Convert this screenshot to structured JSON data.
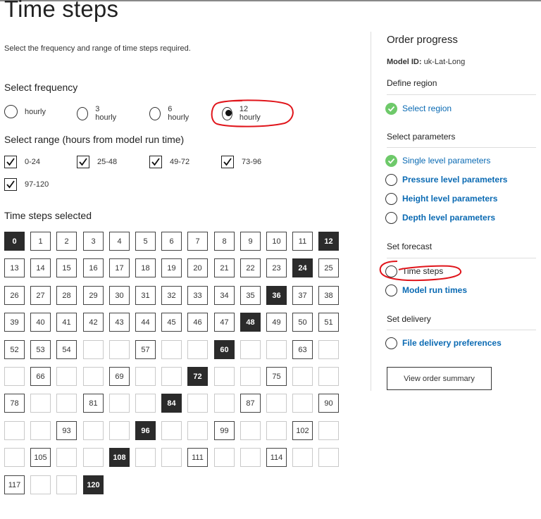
{
  "page": {
    "title": "Time steps",
    "intro": "Select the frequency and range of time steps required."
  },
  "frequency": {
    "heading": "Select frequency",
    "options": [
      "hourly",
      "3 hourly",
      "6 hourly",
      "12 hourly"
    ],
    "selected": "12 hourly"
  },
  "range": {
    "heading": "Select range (hours from model run time)",
    "options": [
      {
        "label": "0-24",
        "checked": true
      },
      {
        "label": "25-48",
        "checked": true
      },
      {
        "label": "49-72",
        "checked": true
      },
      {
        "label": "73-96",
        "checked": true
      },
      {
        "label": "97-120",
        "checked": true
      }
    ]
  },
  "timesteps": {
    "heading": "Time steps selected",
    "rows": [
      [
        "0",
        "1",
        "2",
        "3",
        "4",
        "5",
        "6",
        "7",
        "8",
        "9",
        "10",
        "11",
        "12"
      ],
      [
        "13",
        "14",
        "15",
        "16",
        "17",
        "18",
        "19",
        "20",
        "21",
        "22",
        "23",
        "24",
        "25"
      ],
      [
        "26",
        "27",
        "28",
        "29",
        "30",
        "31",
        "32",
        "33",
        "34",
        "35",
        "36",
        "37",
        "38"
      ],
      [
        "39",
        "40",
        "41",
        "42",
        "43",
        "44",
        "45",
        "46",
        "47",
        "48",
        "49",
        "50",
        "51"
      ],
      [
        "52",
        "53",
        "54",
        "",
        "",
        "57",
        "",
        "",
        "60",
        "",
        "",
        "63",
        ""
      ],
      [
        "",
        "66",
        "",
        "",
        "69",
        "",
        "",
        "72",
        "",
        "",
        "75",
        "",
        ""
      ],
      [
        "78",
        "",
        "",
        "81",
        "",
        "",
        "84",
        "",
        "",
        "87",
        "",
        "",
        "90"
      ],
      [
        "",
        "",
        "93",
        "",
        "",
        "96",
        "",
        "",
        "99",
        "",
        "",
        "102",
        ""
      ],
      [
        "",
        "105",
        "",
        "",
        "108",
        "",
        "",
        "111",
        "",
        "",
        "114",
        "",
        ""
      ],
      [
        "117",
        "",
        "",
        "120"
      ]
    ],
    "highlighted": [
      "0",
      "12",
      "24",
      "36",
      "48",
      "60",
      "72",
      "84",
      "96",
      "108",
      "120"
    ]
  },
  "sidebar": {
    "title": "Order progress",
    "model_label": "Model ID:",
    "model_value": "uk-Lat-Long",
    "sections": [
      {
        "heading": "Define region",
        "items": [
          {
            "label": "Select region",
            "done": true,
            "bold": false
          }
        ]
      },
      {
        "heading": "Select parameters",
        "items": [
          {
            "label": "Single level parameters",
            "done": true,
            "bold": false
          },
          {
            "label": "Pressure level parameters",
            "done": false,
            "bold": true
          },
          {
            "label": "Height level parameters",
            "done": false,
            "bold": true
          },
          {
            "label": "Depth level parameters",
            "done": false,
            "bold": true
          }
        ]
      },
      {
        "heading": "Set forecast",
        "items": [
          {
            "label": "Time steps",
            "done": false,
            "bold": false,
            "current": true
          },
          {
            "label": "Model run times",
            "done": false,
            "bold": true
          }
        ]
      },
      {
        "heading": "Set delivery",
        "items": [
          {
            "label": "File delivery preferences",
            "done": false,
            "bold": true
          }
        ]
      }
    ],
    "summary_button": "View order summary"
  },
  "colors": {
    "link": "#0a6ab3",
    "done": "#6ec96a",
    "annotation": "#e0151b",
    "selected_cell": "#2b2b2b"
  }
}
